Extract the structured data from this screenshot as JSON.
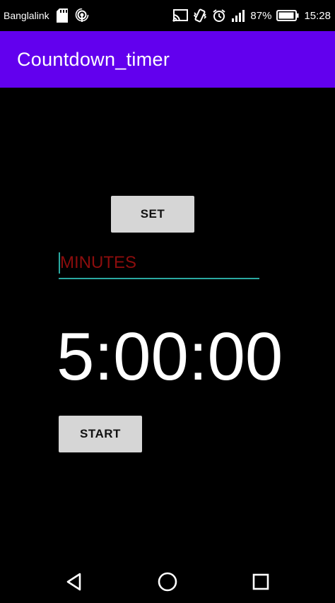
{
  "status_bar": {
    "carrier": "Banglalink",
    "battery_percent": "87%",
    "time": "15:28",
    "icons": [
      "sd-card-icon",
      "hotspot-icon",
      "cast-icon",
      "vibrate-icon",
      "alarm-icon",
      "signal-icon",
      "battery-icon"
    ]
  },
  "app_bar": {
    "title": "Countdown_timer",
    "color": "#6200ee"
  },
  "set_button": {
    "label": "SET"
  },
  "minutes_input": {
    "placeholder": "MINUTES",
    "value": ""
  },
  "timer": {
    "display": "5:00:00"
  },
  "start_button": {
    "label": "START"
  },
  "nav_bar": {
    "icons": [
      "back-icon",
      "home-icon",
      "recents-icon"
    ]
  }
}
